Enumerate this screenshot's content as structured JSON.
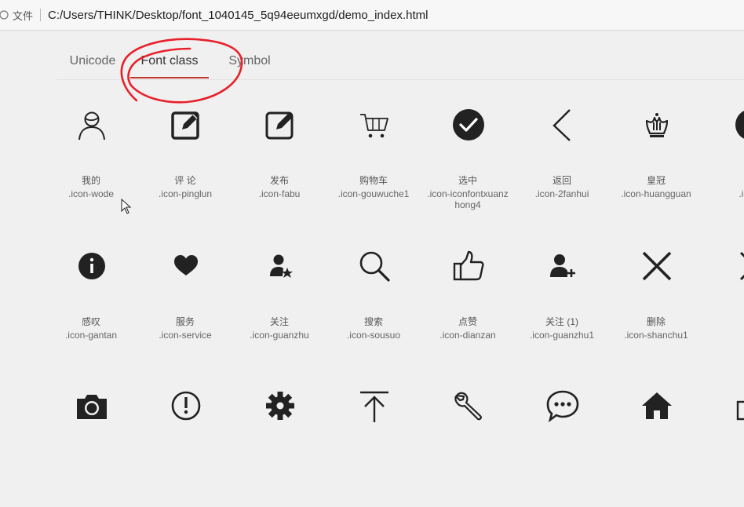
{
  "address_bar": {
    "file_label": "文件",
    "url": "C:/Users/THINK/Desktop/font_1040145_5q94eeumxgd/demo_index.html"
  },
  "tabs": [
    {
      "label": "Unicode"
    },
    {
      "label": "Font class",
      "active": true
    },
    {
      "label": "Symbol"
    }
  ],
  "accent_color": "#c0392b",
  "annotation_color": "#e8202a",
  "icons": [
    {
      "name": "我的",
      "class": ".icon-wode",
      "icon": "user-outline-icon"
    },
    {
      "name": "评 论",
      "class": ".icon-pinglun",
      "icon": "edit-square-filled-icon"
    },
    {
      "name": "发布",
      "class": ".icon-fabu",
      "icon": "edit-square-outline-icon"
    },
    {
      "name": "购物车",
      "class": ".icon-gouwuche1",
      "icon": "shopping-cart-icon"
    },
    {
      "name": "选中",
      "class": ".icon-iconfontxuanzhong4",
      "icon": "check-circle-icon"
    },
    {
      "name": "返回",
      "class": ".icon-2fanhui",
      "icon": "chevron-left-icon"
    },
    {
      "name": "皇冠",
      "class": ".icon-huangguan",
      "icon": "crown-icon"
    },
    {
      "name": "",
      "class": ".icon-",
      "icon": "partial-circle-icon"
    },
    {
      "name": "感叹",
      "class": ".icon-gantan",
      "icon": "info-circle-icon"
    },
    {
      "name": "服务",
      "class": ".icon-service",
      "icon": "heart-icon"
    },
    {
      "name": "关注",
      "class": ".icon-guanzhu",
      "icon": "user-star-icon"
    },
    {
      "name": "搜索",
      "class": ".icon-sousuo",
      "icon": "search-icon"
    },
    {
      "name": "点赞",
      "class": ".icon-dianzan",
      "icon": "thumbs-up-icon"
    },
    {
      "name": "关注 (1)",
      "class": ".icon-guanzhu1",
      "icon": "user-add-icon"
    },
    {
      "name": "删除",
      "class": ".icon-shanchu1",
      "icon": "close-x-icon"
    },
    {
      "name": "",
      "class": ".ic",
      "icon": "partial-arrows-icon"
    },
    {
      "name": "",
      "class": "",
      "icon": "camera-icon"
    },
    {
      "name": "",
      "class": "",
      "icon": "exclamation-circle-icon"
    },
    {
      "name": "",
      "class": "",
      "icon": "gear-icon"
    },
    {
      "name": "",
      "class": "",
      "icon": "upload-top-icon"
    },
    {
      "name": "",
      "class": "",
      "icon": "wrench-icon"
    },
    {
      "name": "",
      "class": "",
      "icon": "chat-bubble-icon"
    },
    {
      "name": "",
      "class": "",
      "icon": "home-icon"
    },
    {
      "name": "",
      "class": "",
      "icon": "partial-box-icon"
    }
  ]
}
